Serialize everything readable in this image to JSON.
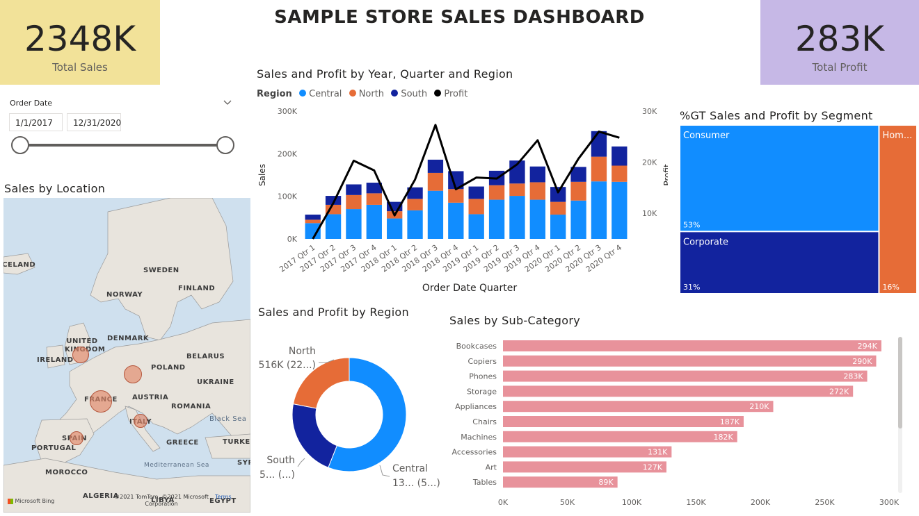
{
  "header": {
    "title": "SAMPLE STORE SALES DASHBOARD"
  },
  "kpis": {
    "sales": {
      "value": "2348K",
      "label": "Total Sales",
      "bg": "#f2e299"
    },
    "profit": {
      "value": "283K",
      "label": "Total Profit",
      "bg": "#c6b8e6"
    }
  },
  "slicer": {
    "label": "Order Date",
    "start": "1/1/2017",
    "end": "12/31/2020",
    "range_fraction": [
      0,
      1
    ]
  },
  "map": {
    "title": "Sales by Location",
    "countries": [
      "ICELAND",
      "SWEDEN",
      "FINLAND",
      "NORWAY",
      "UNITED KINGDOM",
      "IRELAND",
      "DENMARK",
      "BELARUS",
      "POLAND",
      "UKRAINE",
      "FRANCE",
      "AUSTRIA",
      "ROMANIA",
      "ITALY",
      "SPAIN",
      "PORTUGAL",
      "GREECE",
      "TURKEY",
      "MOROCCO",
      "ALGERIA",
      "LIBYA",
      "EGYPT",
      "SYR"
    ],
    "sea_labels": [
      "Black Sea",
      "Mediterranean Sea"
    ],
    "attribution": [
      "Microsoft Bing",
      "©2021 TomTom, ©2021 Microsoft Corporation",
      "Terms"
    ]
  },
  "colors": {
    "central": "#118dff",
    "north": "#e66c37",
    "south": "#12239e",
    "profit": "#000000",
    "subcat": "#e8929b"
  },
  "chart_data": [
    {
      "id": "year-quarter-region",
      "type": "bar",
      "title": "Sales and Profit by Year, Quarter and Region",
      "legend_title": "Region",
      "legend": [
        "Central",
        "North",
        "South",
        "Profit"
      ],
      "xlabel": "Order Date Quarter",
      "ylabel": "Sales",
      "y2label": "Profit",
      "ylim": [
        0,
        300000
      ],
      "y2lim": [
        5000,
        30000
      ],
      "yticks": [
        "0K",
        "100K",
        "200K",
        "300K"
      ],
      "y2ticks": [
        "10K",
        "20K",
        "30K"
      ],
      "categories": [
        "2017 Qtr 1",
        "2017 Qtr 2",
        "2017 Qtr 3",
        "2017 Qtr 4",
        "2018 Qtr 1",
        "2018 Qtr 2",
        "2018 Qtr 3",
        "2018 Qtr 4",
        "2019 Qtr 1",
        "2019 Qtr 2",
        "2019 Qtr 3",
        "2019 Qtr 4",
        "2020 Qtr 1",
        "2020 Qtr 2",
        "2020 Qtr 3",
        "2020 Qtr 4"
      ],
      "series": [
        {
          "name": "Central",
          "values": [
            37000,
            58000,
            70000,
            80000,
            48000,
            67000,
            113000,
            85000,
            58000,
            92000,
            101000,
            92000,
            57000,
            90000,
            135000,
            134000
          ]
        },
        {
          "name": "North",
          "values": [
            8000,
            22000,
            33000,
            27000,
            17000,
            27000,
            42000,
            32000,
            36000,
            34000,
            29000,
            41000,
            30000,
            44000,
            58000,
            38000
          ]
        },
        {
          "name": "South",
          "values": [
            12000,
            21000,
            25000,
            25000,
            22000,
            27000,
            31000,
            42000,
            29000,
            34000,
            54000,
            37000,
            35000,
            35000,
            60000,
            45000
          ]
        },
        {
          "name": "Profit",
          "axis": "secondary",
          "values": [
            5000,
            12000,
            20300,
            18400,
            9600,
            16600,
            27300,
            14700,
            17000,
            16800,
            19600,
            24300,
            14100,
            20700,
            26000,
            24800
          ]
        }
      ]
    },
    {
      "id": "segment-treemap",
      "type": "treemap",
      "title": "%GT Sales and Profit by Segment",
      "items": [
        {
          "name": "Consumer",
          "pct": "53%",
          "share": 0.53,
          "color": "#118dff"
        },
        {
          "name": "Corporate",
          "pct": "31%",
          "share": 0.31,
          "color": "#12239e"
        },
        {
          "name": "Hom...",
          "pct": "16%",
          "share": 0.16,
          "color": "#e66c37"
        }
      ]
    },
    {
      "id": "region-donut",
      "type": "pie",
      "title": "Sales and Profit by Region",
      "slices": [
        {
          "name": "Central",
          "value": 0.56,
          "label": [
            "Central",
            "13... (5...)"
          ]
        },
        {
          "name": "South",
          "value": 0.22,
          "label": [
            "South",
            "5... (...)"
          ]
        },
        {
          "name": "North",
          "value": 0.22,
          "label": [
            "North",
            "516K (22...)"
          ]
        }
      ]
    },
    {
      "id": "subcategory",
      "type": "bar",
      "orientation": "horizontal",
      "title": "Sales by Sub-Category",
      "xlim": [
        0,
        300000
      ],
      "xticks": [
        "0K",
        "50K",
        "100K",
        "150K",
        "200K",
        "250K",
        "300K"
      ],
      "categories": [
        "Bookcases",
        "Copiers",
        "Phones",
        "Storage",
        "Appliances",
        "Chairs",
        "Machines",
        "Accessories",
        "Art",
        "Tables"
      ],
      "values": [
        294000,
        290000,
        283000,
        272000,
        210000,
        187000,
        182000,
        131000,
        127000,
        89000
      ],
      "labels": [
        "294K",
        "290K",
        "283K",
        "272K",
        "210K",
        "187K",
        "182K",
        "131K",
        "127K",
        "89K"
      ]
    }
  ]
}
